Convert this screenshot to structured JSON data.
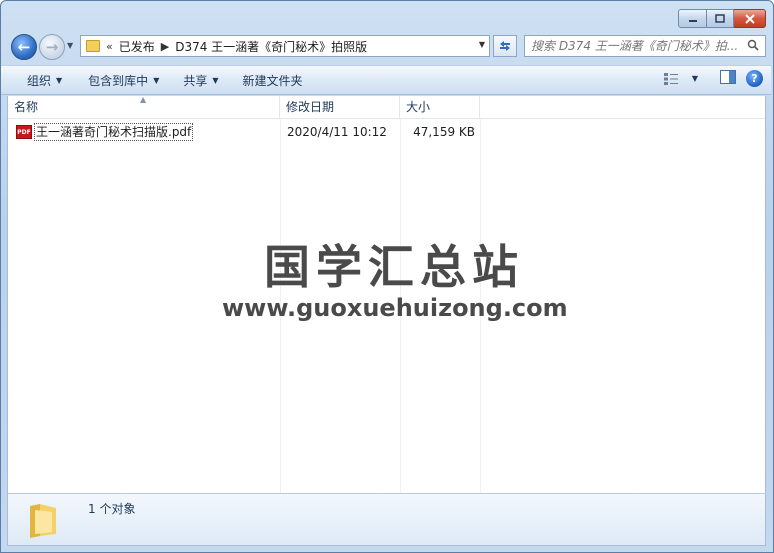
{
  "address": {
    "overflow": "«",
    "crumbs": [
      "已发布",
      "D374 王一涵著《奇门秘术》拍照版"
    ]
  },
  "search": {
    "placeholder": "搜索 D374 王一涵著《奇门秘术》拍..."
  },
  "toolbar": {
    "organize": "组织",
    "include_library": "包含到库中",
    "share": "共享",
    "new_folder": "新建文件夹"
  },
  "columns": {
    "name": "名称",
    "date": "修改日期",
    "size": "大小"
  },
  "files": [
    {
      "name": "王一涵著奇门秘术扫描版.pdf",
      "date": "2020/4/11 10:12",
      "size": "47,159 KB",
      "icon": "pdf-icon"
    }
  ],
  "watermark": {
    "title": "国学汇总站",
    "url": "www.guoxuehuizong.com"
  },
  "details": {
    "count": "1 个对象"
  },
  "icons": {
    "back": "←",
    "forward": "→",
    "help": "?",
    "pdf": "PDF"
  },
  "colors": {
    "accent": "#2f6fc4",
    "close": "#c13c22",
    "pdf": "#c8161d"
  }
}
